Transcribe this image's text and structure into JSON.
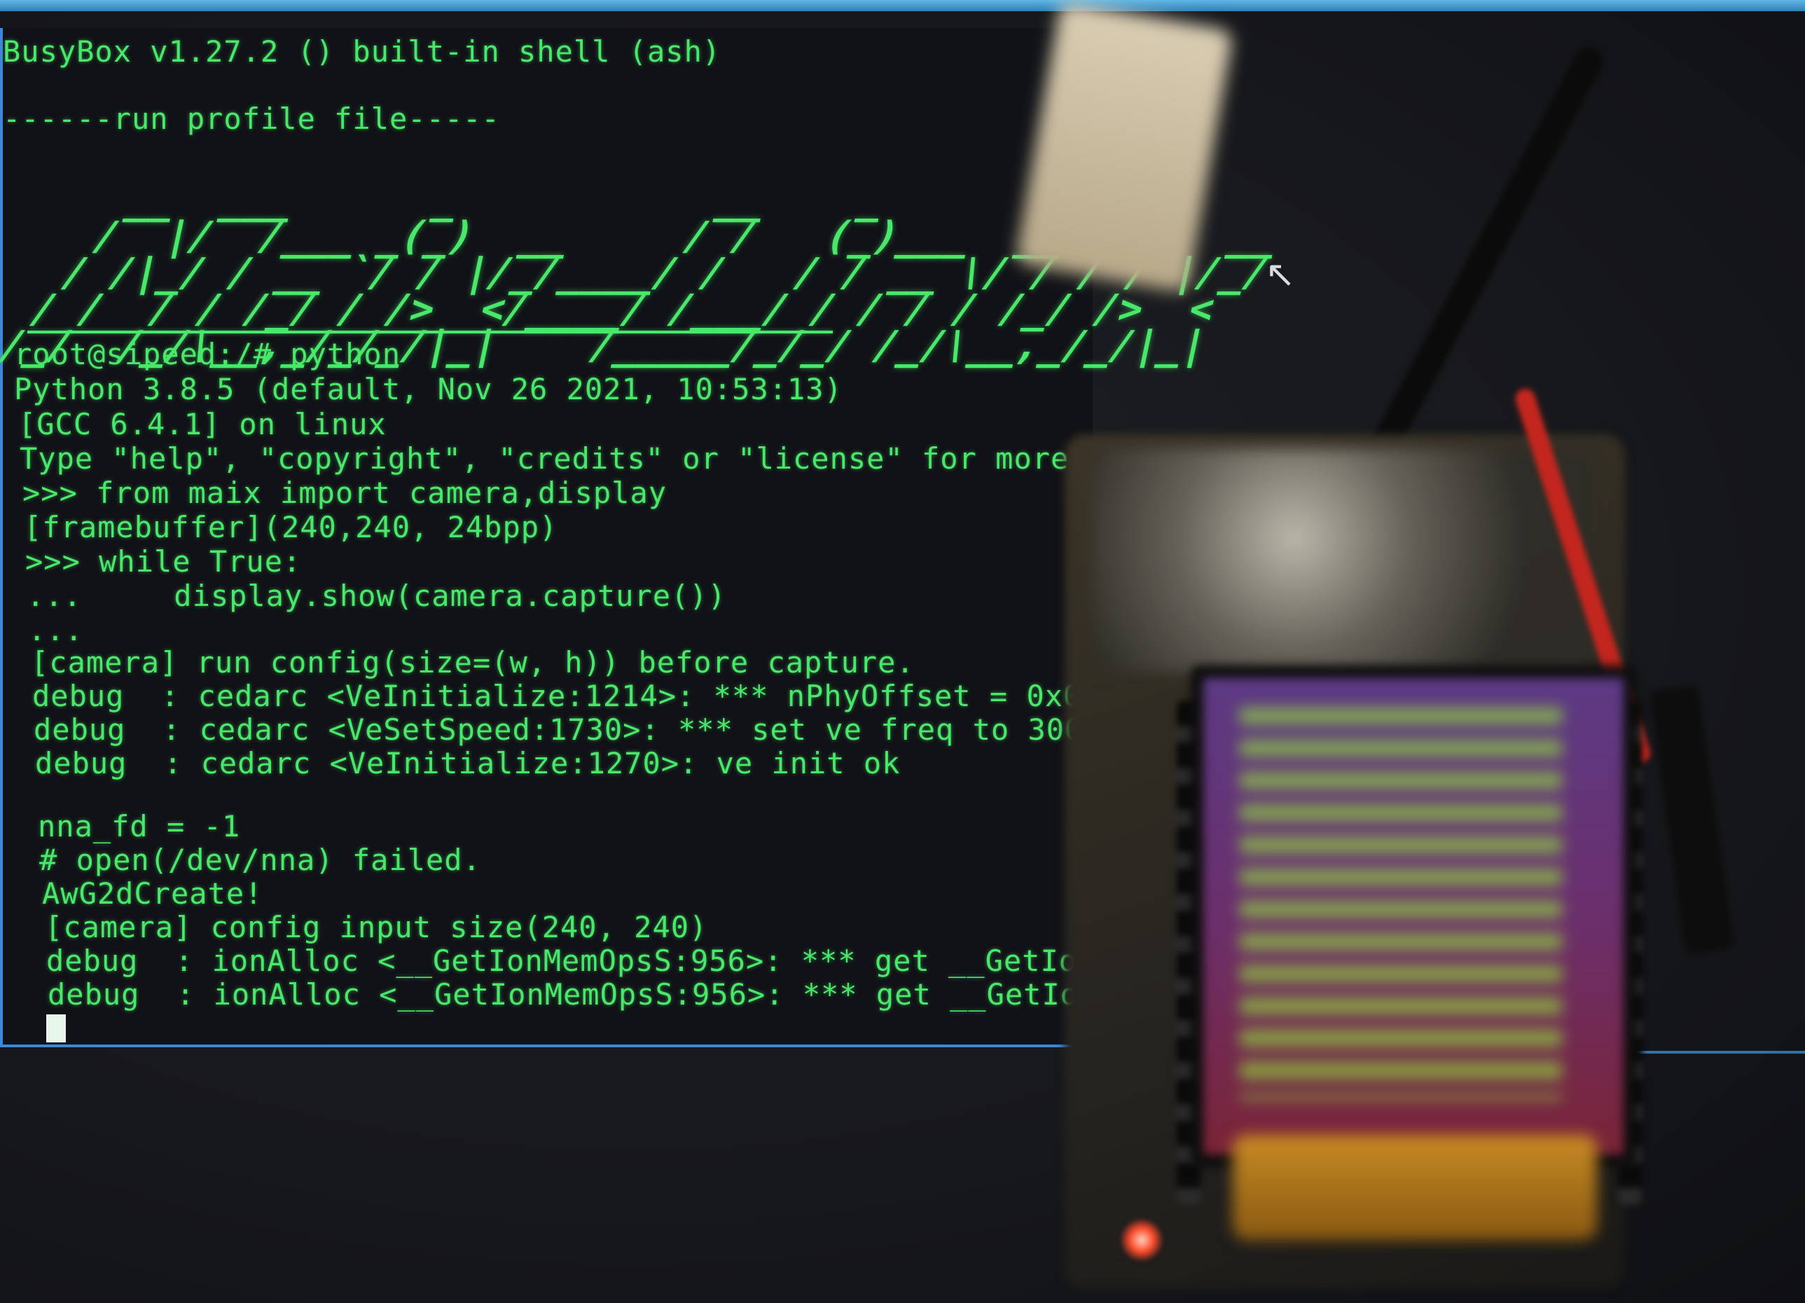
{
  "terminal": {
    "lines": [
      "BusyBox v1.27.2 () built-in shell (ash)",
      "------run profile file-----",
      "root@sipeed:/# python",
      "Python 3.8.5 (default, Nov 26 2021, 10:53:13)",
      "[GCC 6.4.1] on linux",
      "Type \"help\", \"copyright\", \"credits\" or \"license\" for more informatio",
      ">>> from maix import camera,display",
      "[framebuffer](240,240, 24bpp)",
      ">>> while True:",
      "...     display.show(camera.capture())",
      "...",
      "[camera] run config(size=(w, h)) before capture.",
      "debug  : cedarc <VeInitialize:1214>: *** nPhyOffset = 0x0",
      "debug  : cedarc <VeSetSpeed:1730>: *** set ve freq to 300",
      "debug  : cedarc <VeInitialize:1270>: ve init ok",
      "nna_fd = -1",
      "# open(/dev/nna) failed.",
      "AwG2dCreate!",
      "[camera] config input size(240, 240)",
      "debug  : ionAlloc <__GetIonMemOpsS:956>: *** get __GetIonMemOp",
      "debug  : ionAlloc <__GetIonMemOpsS:956>: *** get __GetIonMemOp"
    ],
    "banner_art": "    __  ___      _           __    _\n   /  |/  /___ _(_)  __     / /   (_)___  __  ___  __\n  / /|_/ / __ `/ / |/_/____/ /   / / __ \\/ / / / |/_/\n / /  / / /_/ / />  </____/ /___/ / / / / /_/ />  <\n/_/  /_/\\__,_/_/_/|_|    /_____/_/_/ /_/\\__,_/_/|_|"
  },
  "colors": {
    "terminal_text": "#49e86a",
    "terminal_bg": "#111217",
    "window_border": "#3d86d8"
  }
}
